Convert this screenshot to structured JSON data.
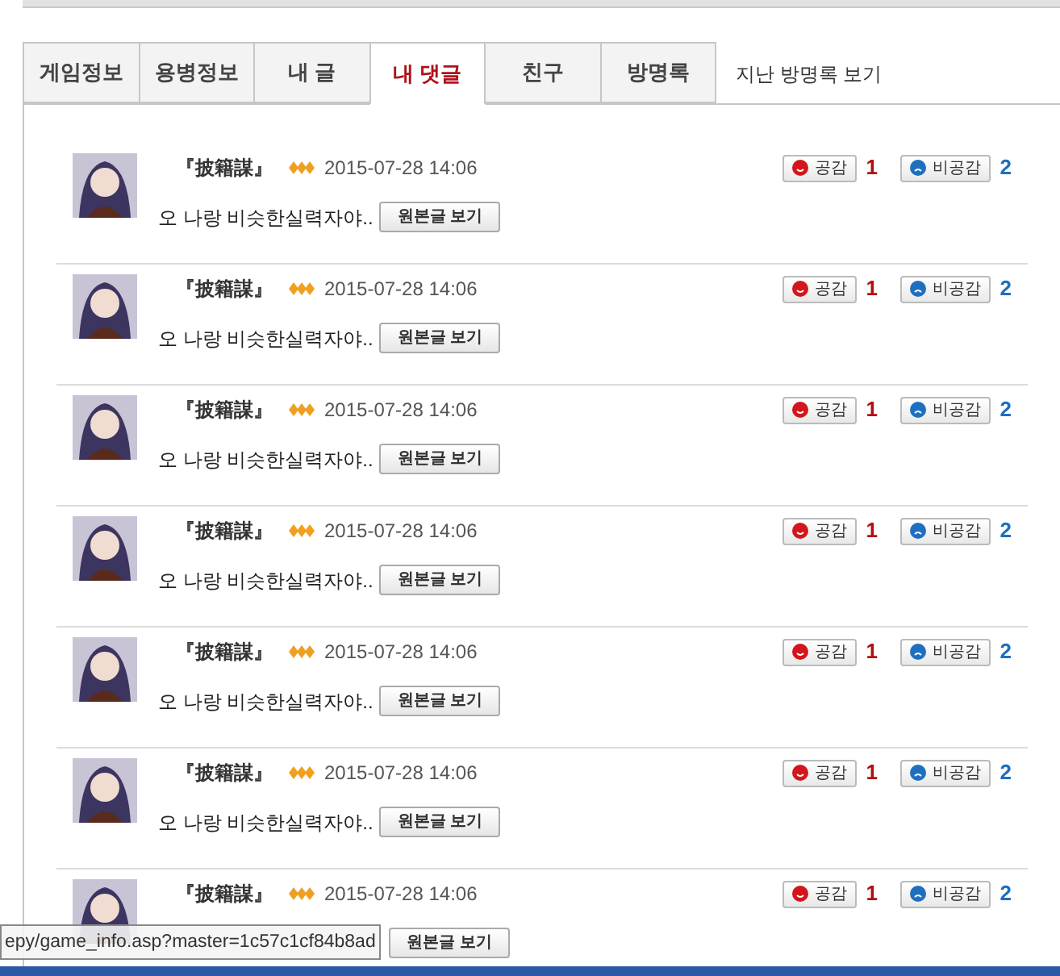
{
  "tabs": [
    {
      "label": "게임정보",
      "selected": false
    },
    {
      "label": "용병정보",
      "selected": false
    },
    {
      "label": "내 글",
      "selected": false
    },
    {
      "label": "내 댓글",
      "selected": true
    },
    {
      "label": "친구",
      "selected": false
    },
    {
      "label": "방명록",
      "selected": false
    }
  ],
  "side_link": "지난 방명록 보기",
  "comments": [
    {
      "name": "『披籍謀』",
      "date": "2015-07-28 14:06",
      "text": "오 나랑 비슷한실력자야..",
      "view_button": "원본글 보기",
      "like_label": "공감",
      "like_count": "1",
      "dislike_label": "비공감",
      "dislike_count": "2"
    },
    {
      "name": "『披籍謀』",
      "date": "2015-07-28 14:06",
      "text": "오 나랑 비슷한실력자야..",
      "view_button": "원본글 보기",
      "like_label": "공감",
      "like_count": "1",
      "dislike_label": "비공감",
      "dislike_count": "2"
    },
    {
      "name": "『披籍謀』",
      "date": "2015-07-28 14:06",
      "text": "오 나랑 비슷한실력자야..",
      "view_button": "원본글 보기",
      "like_label": "공감",
      "like_count": "1",
      "dislike_label": "비공감",
      "dislike_count": "2"
    },
    {
      "name": "『披籍謀』",
      "date": "2015-07-28 14:06",
      "text": "오 나랑 비슷한실력자야..",
      "view_button": "원본글 보기",
      "like_label": "공감",
      "like_count": "1",
      "dislike_label": "비공감",
      "dislike_count": "2"
    },
    {
      "name": "『披籍謀』",
      "date": "2015-07-28 14:06",
      "text": "오 나랑 비슷한실력자야..",
      "view_button": "원본글 보기",
      "like_label": "공감",
      "like_count": "1",
      "dislike_label": "비공감",
      "dislike_count": "2"
    },
    {
      "name": "『披籍謀』",
      "date": "2015-07-28 14:06",
      "text": "오 나랑 비슷한실력자야..",
      "view_button": "원본글 보기",
      "like_label": "공감",
      "like_count": "1",
      "dislike_label": "비공감",
      "dislike_count": "2"
    },
    {
      "name": "『披籍謀』",
      "date": "2015-07-28 14:06",
      "view_button": "원본글 보기",
      "like_label": "공감",
      "like_count": "1",
      "dislike_label": "비공감",
      "dislike_count": "2"
    }
  ],
  "status_url": "epy/game_info.asp?master=1c57c1cf84b8ad"
}
